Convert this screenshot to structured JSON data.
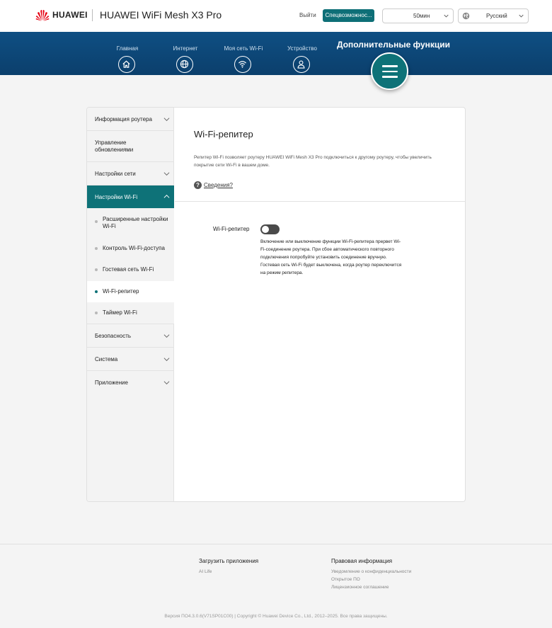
{
  "header": {
    "brand": "HUAWEI",
    "product": "HUAWEI WiFi Mesh X3 Pro",
    "logout_label": "Выйти",
    "special_label": "Спецвозможнос...",
    "session_timeout": "50мин",
    "language": "Русский"
  },
  "nav": {
    "items": [
      {
        "label": "Главная",
        "icon": "home-icon"
      },
      {
        "label": "Интернет",
        "icon": "globe-icon"
      },
      {
        "label": "Моя сеть Wi-Fi",
        "icon": "wifi-icon"
      },
      {
        "label": "Устройство",
        "icon": "user-icon"
      }
    ],
    "active_label": "Дополнительные функции",
    "active_icon": "hamburger-menu-icon"
  },
  "sidebar": {
    "items": [
      {
        "label": "Информация роутера"
      },
      {
        "label": "Управление обновлениями"
      },
      {
        "label": "Настройки сети"
      },
      {
        "label": "Настройки Wi-Fi"
      },
      {
        "label": "Безопасность"
      },
      {
        "label": "Система"
      },
      {
        "label": "Приложение"
      }
    ],
    "subitems": [
      {
        "label": "Расширенные настройки Wi-Fi"
      },
      {
        "label": "Контроль Wi-Fi-доступа"
      },
      {
        "label": "Гостевая сеть Wi-Fi"
      },
      {
        "label": "Wi-Fi-репитер"
      },
      {
        "label": "Таймер Wi-Fi"
      }
    ]
  },
  "content": {
    "title": "Wi-Fi-репитер",
    "description": "Репитер Wi-Fi позволяет роутеру HUAWEI WiFi Mesh X3 Pro подключиться к другому роутеру, чтобы увеличить покрытие сети Wi-Fi в вашем доме.",
    "help_label": "Сведения?",
    "field_label": "Wi-Fi-репитер",
    "toggle_state": "off",
    "field_help_1": "Включение или выключение функции Wi-Fi-репитера прервет Wi-Fi-соединение роутера. При сбое автоматического повторного подключения попробуйте установить соединение вручную.",
    "field_help_2": "Гостевая сеть Wi-Fi будет выключена, когда роутер переключится на режим репитера."
  },
  "footer": {
    "col1_title": "Загрузить приложения",
    "col1_links": [
      "AI Life"
    ],
    "col2_title": "Правовая информация",
    "col2_links": [
      "Уведомление о конфиденциальности",
      "Открытое ПО",
      "Лицензионное соглашение"
    ],
    "copyright": "Версия ПО4.3.0.6(V71SP01C00) | Copyright © Huawei Device Co., Ltd., 2012–2025. Все права защищены."
  },
  "colors": {
    "accent": "#0e7278",
    "nav_bg": "#0f4f83",
    "brand_red": "#e60012"
  }
}
